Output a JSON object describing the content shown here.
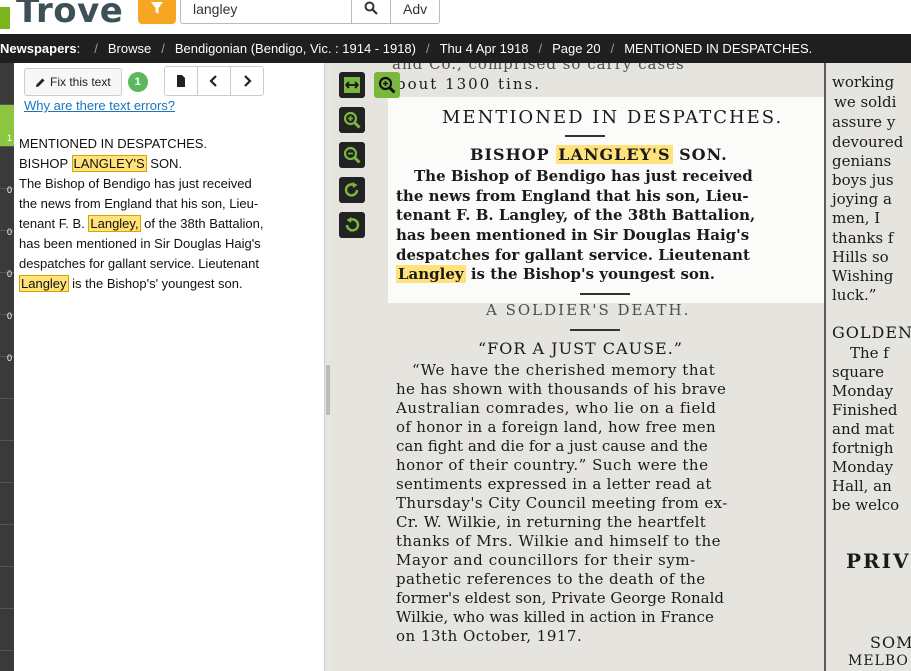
{
  "header": {
    "logo_text": "Trove",
    "search_value": "langley",
    "adv_label": "Adv",
    "accent_color": "#f6a623",
    "brand_color": "#7ab51d"
  },
  "breadcrumb": {
    "root": "Newspapers",
    "items": [
      "Browse",
      "Bendigonian (Bendigo, Vic. : 1914 - 1918)",
      "Thu 4 Apr 1918",
      "Page 20",
      "MENTIONED IN DESPATCHES."
    ]
  },
  "strip": {
    "counts": [
      "1",
      "0",
      "0",
      "0",
      "0",
      "0"
    ]
  },
  "toolbar": {
    "fix_label": "Fix this text",
    "badge_count": "1",
    "why_link": "Why are there text errors?"
  },
  "article": {
    "line1": "MENTIONED IN DESPATCHES.",
    "line2_pre": "BISHOP ",
    "line2_hl": "LANGLEY'S",
    "line2_post": " SON.",
    "line3": "The Bishop of Bendigo has just received",
    "line4": "the news from England that his son, Lieu-",
    "line5_pre": "tenant F. B. ",
    "line5_hl": "Langley,",
    "line5_post": " of the 38th Battalion,",
    "line6": "has been mentioned in Sir Douglas Haig's",
    "line7": "despatches for gallant service. Lieutenant",
    "line8_hl": "Langley",
    "line8_post": " is the Bishop's' youngest son."
  },
  "newspaper": {
    "top_line": "bout 1300 tins.",
    "top_line_faint": "and Co., comprised so carry cases",
    "heading": "MENTIONED IN DESPATCHES.",
    "sub_pre": "BISHOP ",
    "sub_hl": "LANGLEY'S",
    "sub_post": " SON.",
    "body": [
      "The Bishop of Bendigo has just received",
      "the news from England that his son, Lieu-",
      "tenant F. B. Langley, of the 38th Battalion,",
      "has been mentioned in Sir Douglas Haig's",
      "despatches for gallant service. Lieutenant"
    ],
    "last_hl": "Langley",
    "last_post": " is the Bishop's youngest son.",
    "soldier_heading": "A SOLDIER'S DEATH.",
    "cause_heading": "“FOR A JUST CAUSE.”",
    "cause_body": [
      "“We have the cherished memory that",
      "he has shown with thousands of his brave",
      "Australian comrades, who lie on a field",
      "of honor in a foreign land, how free men",
      "can fight and die for a just cause and the",
      "honor of their country.” Such were the",
      "sentiments expressed in a letter read at",
      "Thursday's City Council meeting from ex-",
      "Cr. W. Wilkie, in returning the heartfelt",
      "thanks of Mrs. Wilkie and himself to the",
      "Mayor and councillors for their sym-",
      "pathetic references to the death of the",
      "former's eldest son, Private George Ronald",
      "Wilkie, who was killed in action in France",
      "on 13th October, 1917."
    ],
    "right_col": [
      "working",
      "we soldi",
      "assure y",
      "devoured",
      "genians",
      "boys jus",
      "joying a",
      "men, I",
      "thanks f",
      "Hills so",
      "Wishing",
      "luck.”"
    ],
    "right_golden": "GOLDEN",
    "right_col2": [
      "The f",
      "square",
      "Monday",
      "Finished",
      "and mat",
      "fortnigh",
      "Monday",
      "Hall, an",
      "be welco"
    ],
    "right_priv": "PRIV",
    "right_som": "SOM",
    "right_melb": "MELBO"
  },
  "zoom_tools": [
    "fit-width-icon",
    "zoom-tool-icon",
    "zoom-in-icon",
    "zoom-out-icon",
    "rotate-right-icon",
    "rotate-left-icon"
  ]
}
